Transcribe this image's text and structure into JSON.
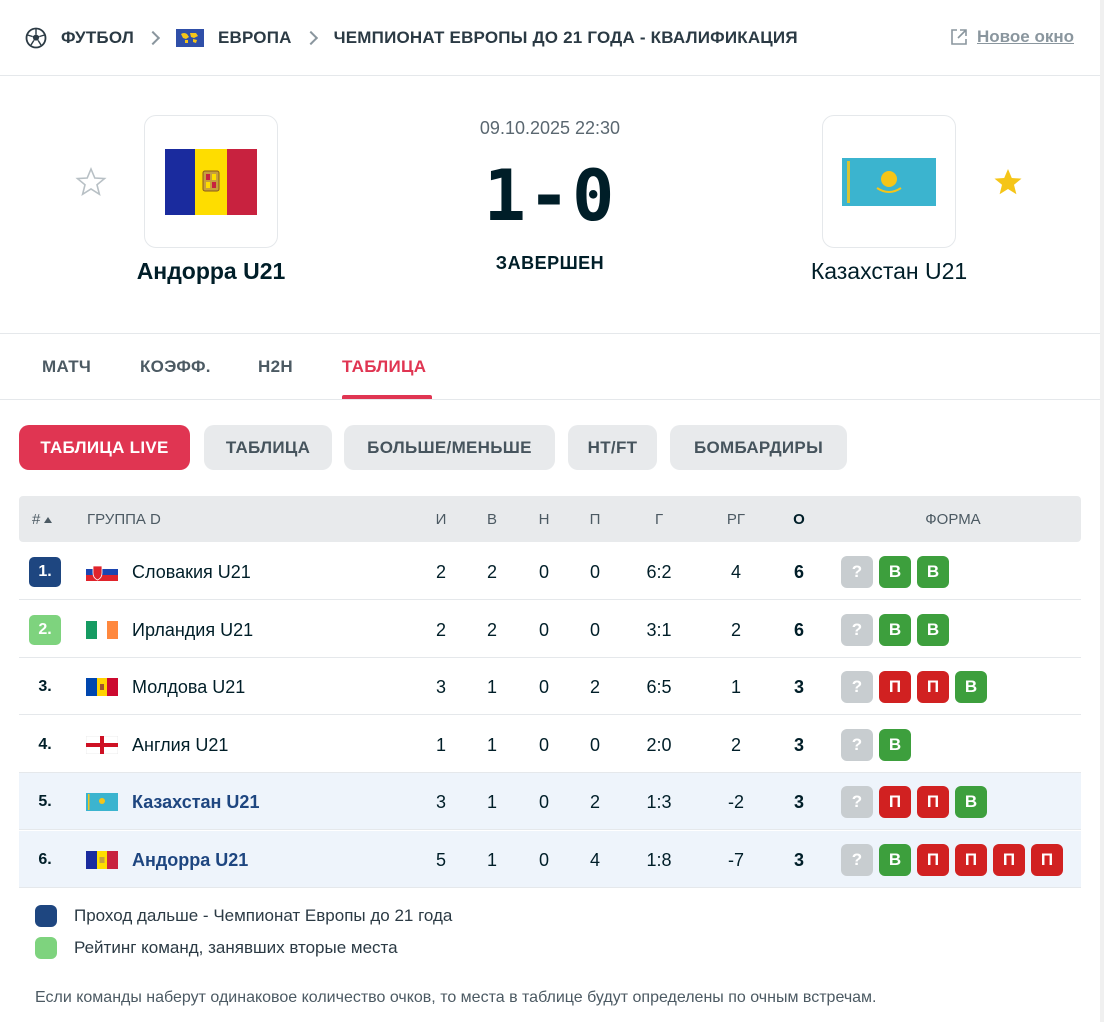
{
  "breadcrumb": {
    "sport": "ФУТБОЛ",
    "region": "ЕВРОПА",
    "competition": "ЧЕМПИОНАТ ЕВРОПЫ ДО 21 ГОДА - КВАЛИФИКАЦИЯ",
    "new_window": "Новое окно"
  },
  "match": {
    "datetime": "09.10.2025 22:30",
    "score": "1-0",
    "status": "ЗАВЕРШЕН",
    "home": {
      "name": "Андорра U21",
      "favorite": false
    },
    "away": {
      "name": "Казахстан U21",
      "favorite": true
    }
  },
  "tabs": [
    {
      "label": "МАТЧ",
      "active": false
    },
    {
      "label": "КОЭФФ.",
      "active": false
    },
    {
      "label": "H2H",
      "active": false
    },
    {
      "label": "ТАБЛИЦА",
      "active": true
    }
  ],
  "subtabs": [
    {
      "label": "ТАБЛИЦА LIVE",
      "active": true
    },
    {
      "label": "ТАБЛИЦА",
      "active": false
    },
    {
      "label": "БОЛЬШЕ/МЕНЬШЕ",
      "active": false
    },
    {
      "label": "HT/FT",
      "active": false
    },
    {
      "label": "БОМБАРДИРЫ",
      "active": false
    }
  ],
  "table": {
    "headers": {
      "rank": "#",
      "group": "ГРУППА D",
      "played": "И",
      "won": "В",
      "draw": "Н",
      "lost": "П",
      "goals": "Г",
      "diff": "РГ",
      "points": "О",
      "form": "ФОРМА"
    },
    "rows": [
      {
        "rank": "1.",
        "qual": "q1",
        "flag": "slovakia",
        "team": "Словакия U21",
        "highlight": false,
        "p": "2",
        "w": "2",
        "d": "0",
        "l": "0",
        "g": "6:2",
        "gd": "4",
        "pts": "6",
        "form": [
          "?",
          "В",
          "В"
        ]
      },
      {
        "rank": "2.",
        "qual": "q2",
        "flag": "ireland",
        "team": "Ирландия U21",
        "highlight": false,
        "p": "2",
        "w": "2",
        "d": "0",
        "l": "0",
        "g": "3:1",
        "gd": "2",
        "pts": "6",
        "form": [
          "?",
          "В",
          "В"
        ]
      },
      {
        "rank": "3.",
        "qual": "",
        "flag": "moldova",
        "team": "Молдова U21",
        "highlight": false,
        "p": "3",
        "w": "1",
        "d": "0",
        "l": "2",
        "g": "6:5",
        "gd": "1",
        "pts": "3",
        "form": [
          "?",
          "П",
          "П",
          "В"
        ]
      },
      {
        "rank": "4.",
        "qual": "",
        "flag": "england",
        "team": "Англия U21",
        "highlight": false,
        "p": "1",
        "w": "1",
        "d": "0",
        "l": "0",
        "g": "2:0",
        "gd": "2",
        "pts": "3",
        "form": [
          "?",
          "В"
        ]
      },
      {
        "rank": "5.",
        "qual": "",
        "flag": "kazakhstan",
        "team": "Казахстан U21",
        "highlight": true,
        "p": "3",
        "w": "1",
        "d": "0",
        "l": "2",
        "g": "1:3",
        "gd": "-2",
        "pts": "3",
        "form": [
          "?",
          "П",
          "П",
          "В"
        ]
      },
      {
        "rank": "6.",
        "qual": "",
        "flag": "andorra",
        "team": "Андорра U21",
        "highlight": true,
        "p": "5",
        "w": "1",
        "d": "0",
        "l": "4",
        "g": "1:8",
        "gd": "-7",
        "pts": "3",
        "form": [
          "?",
          "В",
          "П",
          "П",
          "П",
          "П"
        ]
      }
    ]
  },
  "legend": [
    {
      "color": "#1e4680",
      "text": "Проход дальше - Чемпионат Европы до 21 года"
    },
    {
      "color": "#7ed37e",
      "text": "Рейтинг команд, занявших вторые места"
    }
  ],
  "note": "Если команды наберут одинаковое количество очков, то места в таблице будут определены по очным встречам.",
  "colors": {
    "accent": "#e03552",
    "win": "#3d9f3d",
    "loss": "#d12121",
    "unknown": "#c8cdd0",
    "qual1": "#1e4680",
    "qual2": "#7ed37e"
  }
}
